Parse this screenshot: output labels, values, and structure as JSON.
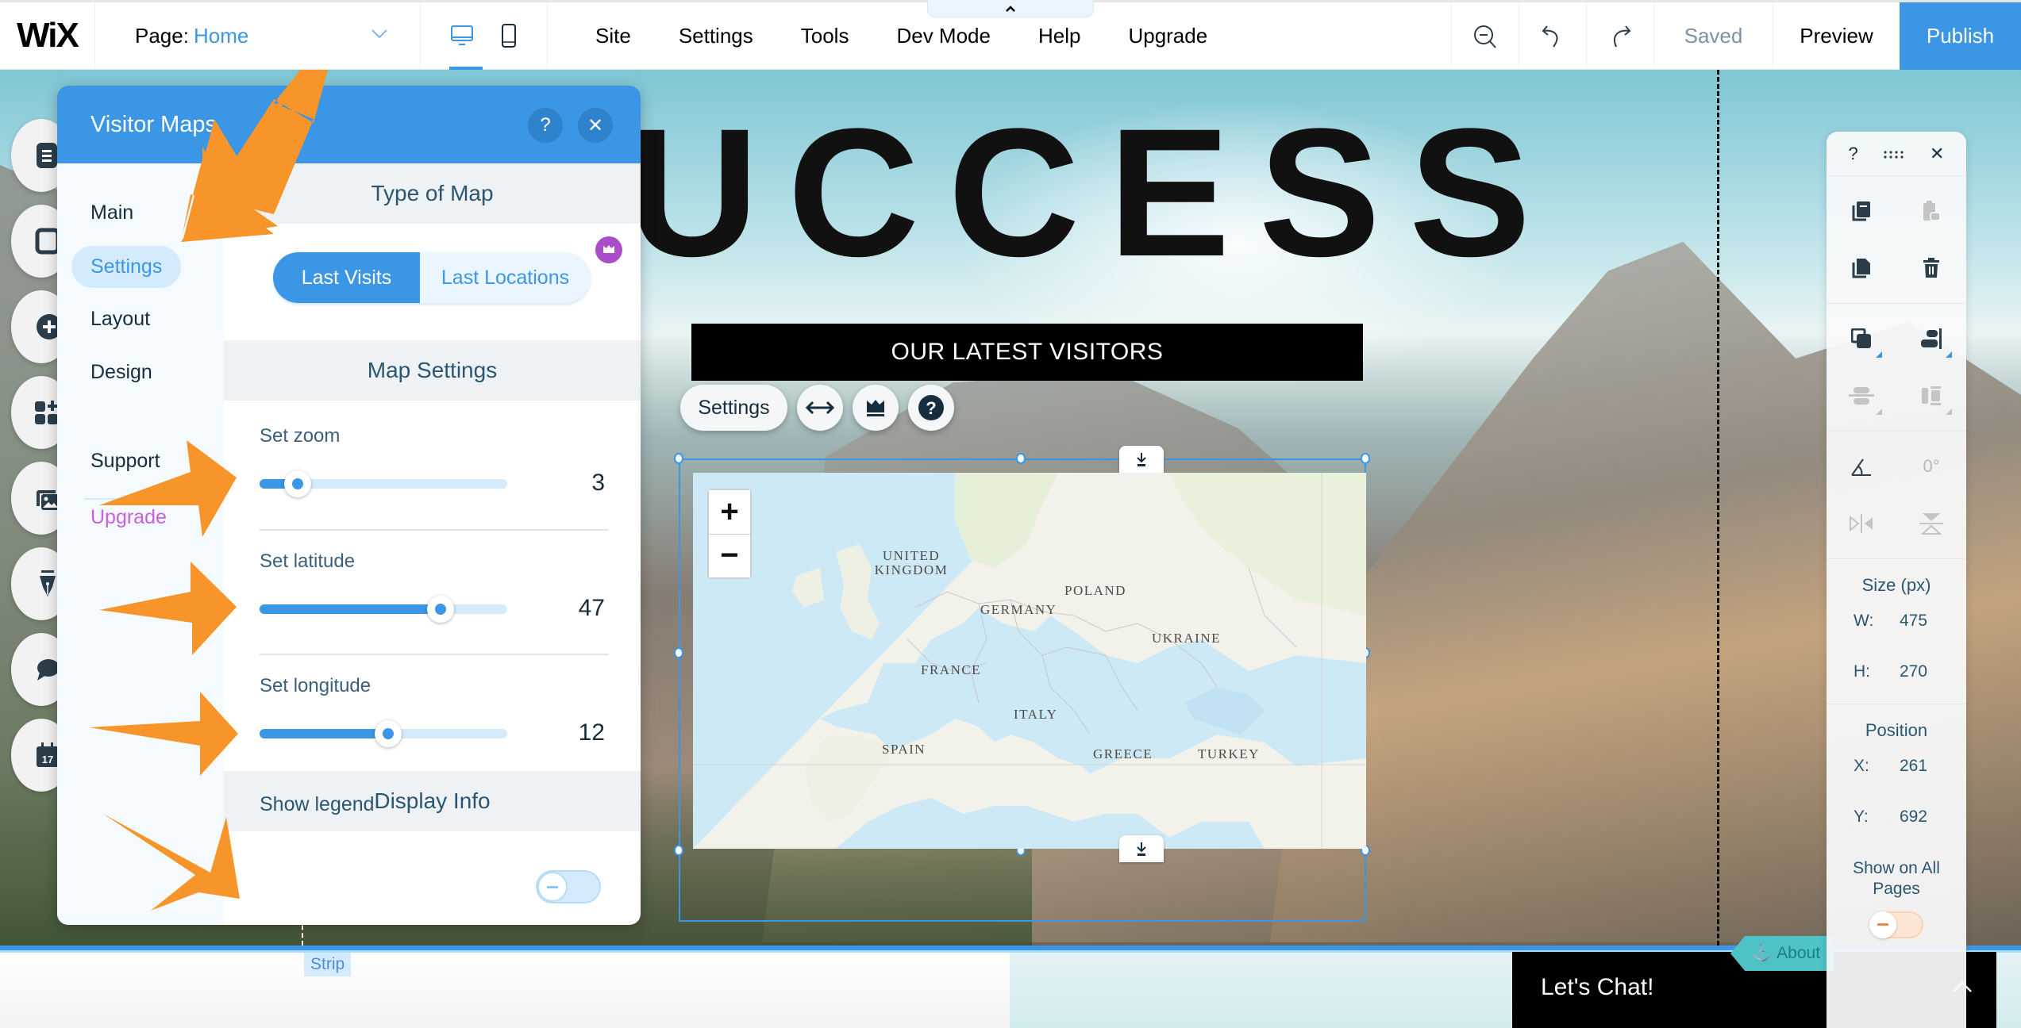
{
  "topbar": {
    "logo": "WiX",
    "page_label": "Page:",
    "page_value": "Home",
    "devices": [
      {
        "name": "desktop",
        "active": true
      },
      {
        "name": "mobile",
        "active": false
      }
    ],
    "menu": [
      "Site",
      "Settings",
      "Tools",
      "Dev Mode",
      "Help",
      "Upgrade"
    ],
    "saved_label": "Saved",
    "preview_label": "Preview",
    "publish_label": "Publish",
    "accent_color": "#3b96e6"
  },
  "canvas": {
    "hero_title": "UCCESS",
    "banner_text": "OUR LATEST VISITORS",
    "element_toolbar": {
      "settings_label": "Settings",
      "icons": [
        "stretch-icon",
        "crown-icon",
        "help-icon"
      ]
    },
    "map": {
      "zoom_in": "+",
      "zoom_out": "−",
      "labels": [
        "UNITED KINGDOM",
        "POLAND",
        "GERMANY",
        "UKRAINE",
        "FRANCE",
        "ITALY",
        "SPAIN",
        "GREECE",
        "TURKEY"
      ]
    }
  },
  "panel": {
    "title": "Visitor Maps",
    "help_label": "?",
    "close_label": "✕",
    "nav": [
      {
        "label": "Main",
        "active": false
      },
      {
        "label": "Settings",
        "active": true
      },
      {
        "label": "Layout",
        "active": false
      },
      {
        "label": "Design",
        "active": false
      },
      {
        "label": "Support",
        "active": false
      },
      {
        "label": "Upgrade",
        "active": false
      }
    ],
    "type_of_map": {
      "header": "Type of Map",
      "options": [
        "Last Visits",
        "Last Locations"
      ],
      "selected": "Last Visits"
    },
    "map_settings": {
      "header": "Map Settings",
      "sliders": [
        {
          "label": "Set zoom",
          "value": "3",
          "fraction": 0.155
        },
        {
          "label": "Set latitude",
          "value": "47",
          "fraction": 0.73
        },
        {
          "label": "Set longitude",
          "value": "12",
          "fraction": 0.52
        }
      ]
    },
    "display_info": {
      "header": "Display Info",
      "show_legend_label": "Show legend",
      "show_legend_on": false
    }
  },
  "inspector": {
    "help": "?",
    "drag": "::::",
    "close": "✕",
    "rotation": "0°",
    "size_title": "Size (px)",
    "w_label": "W:",
    "w_value": "475",
    "h_label": "H:",
    "h_value": "270",
    "position_title": "Position",
    "x_label": "X:",
    "x_value": "261",
    "y_label": "Y:",
    "y_value": "692",
    "show_all_pages": "Show on All Pages",
    "show_all_pages_on": false
  },
  "bottom": {
    "strip_label": "Strip",
    "chat_text": "Let's Chat!",
    "anchor_label": "About"
  }
}
